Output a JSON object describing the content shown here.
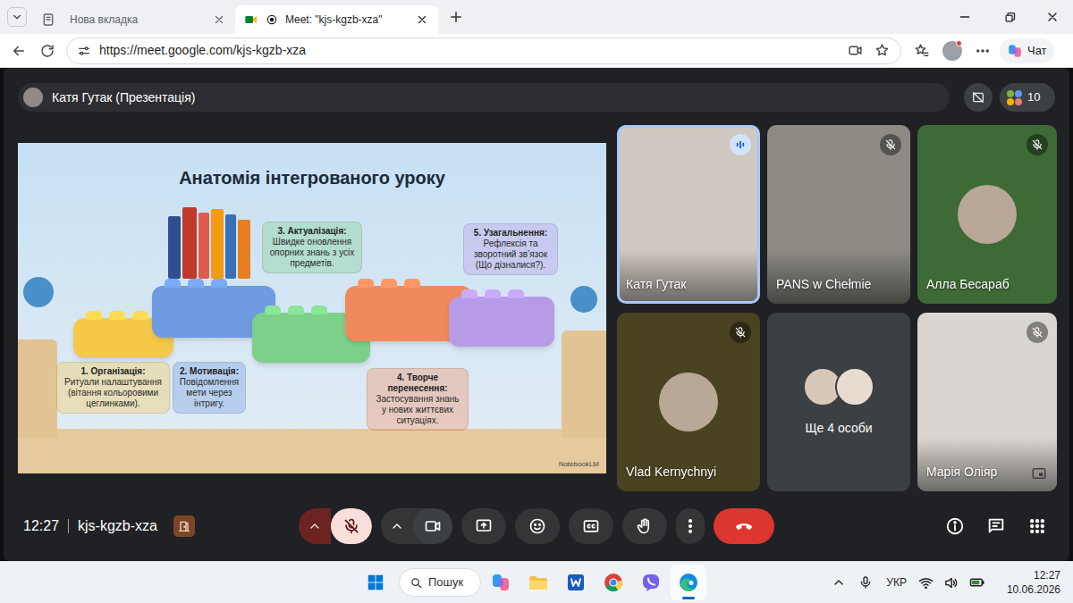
{
  "browser": {
    "tabs": [
      {
        "label": "Нова вкладка",
        "selected": false,
        "kind": "page",
        "capturing": false
      },
      {
        "label": "Meet: \"kjs-kgzb-xza\"",
        "selected": true,
        "kind": "meet",
        "capturing": true
      }
    ],
    "url": "https://meet.google.com/kjs-kgzb-xza",
    "chat_label": "Чат"
  },
  "meet": {
    "presenter": "Катя Гутак (Презентація)",
    "participant_count": "10",
    "slide": {
      "title": "Анатомія інтегрованого уроку",
      "steps": [
        {
          "heading": "1. Організація:",
          "text": "Ритуали налаштування (вітання кольоровими цеглинками).",
          "color": "#f5c84a"
        },
        {
          "heading": "2. Мотивація:",
          "text": "Повідомлення мети через інтригу.",
          "color": "#6f9be0"
        },
        {
          "heading": "3. Актуалізація:",
          "text": "Швидке оновлення опорних знань з усіх предметів.",
          "color": "#7dd08a"
        },
        {
          "heading": "4. Творче перенесення:",
          "text": "Застосування знань у нових життєвих ситуаціях.",
          "color": "#f08a5d"
        },
        {
          "heading": "5. Узагальнення:",
          "text": "Рефлексія та зворотний зв’язок (Що дізналися?).",
          "color": "#b79be6"
        }
      ],
      "watermark": "NotebookLM"
    },
    "tiles": [
      {
        "name": "Катя Гутак",
        "kind": "video",
        "muted": false,
        "speaking": true,
        "self": false,
        "color": "#cfc8c0"
      },
      {
        "name": "PANS w Chełmie",
        "kind": "video",
        "muted": true,
        "speaking": false,
        "self": false,
        "color": "#8d8a84"
      },
      {
        "name": "Алла Бесараб",
        "kind": "avatar",
        "muted": true,
        "speaking": false,
        "self": false,
        "color": "#3e6a35"
      },
      {
        "name": "Vlad Kernychnyi",
        "kind": "avatar",
        "muted": true,
        "speaking": false,
        "self": false,
        "color": "#4a4322"
      },
      {
        "name": "Ще 4 особи",
        "kind": "others",
        "muted": false,
        "speaking": false,
        "self": false,
        "color": "#3c4043"
      },
      {
        "name": "Марія Оліяр",
        "kind": "video",
        "muted": true,
        "speaking": false,
        "self": true,
        "color": "#d9d5d0"
      }
    ],
    "time": "12:27",
    "meeting_code": "kjs-kgzb-xza",
    "controls": {
      "mic_muted": true,
      "camera_on": true
    }
  },
  "taskbar": {
    "search": "Пошук",
    "apps": [
      {
        "kind": "copilot",
        "selected": false
      },
      {
        "kind": "explorer",
        "selected": false
      },
      {
        "kind": "word",
        "selected": false
      },
      {
        "kind": "chrome",
        "selected": false
      },
      {
        "kind": "viber",
        "selected": false
      },
      {
        "kind": "edge",
        "selected": true
      }
    ],
    "language": "УКР",
    "time": "12:27",
    "date": "10.06.2026"
  }
}
